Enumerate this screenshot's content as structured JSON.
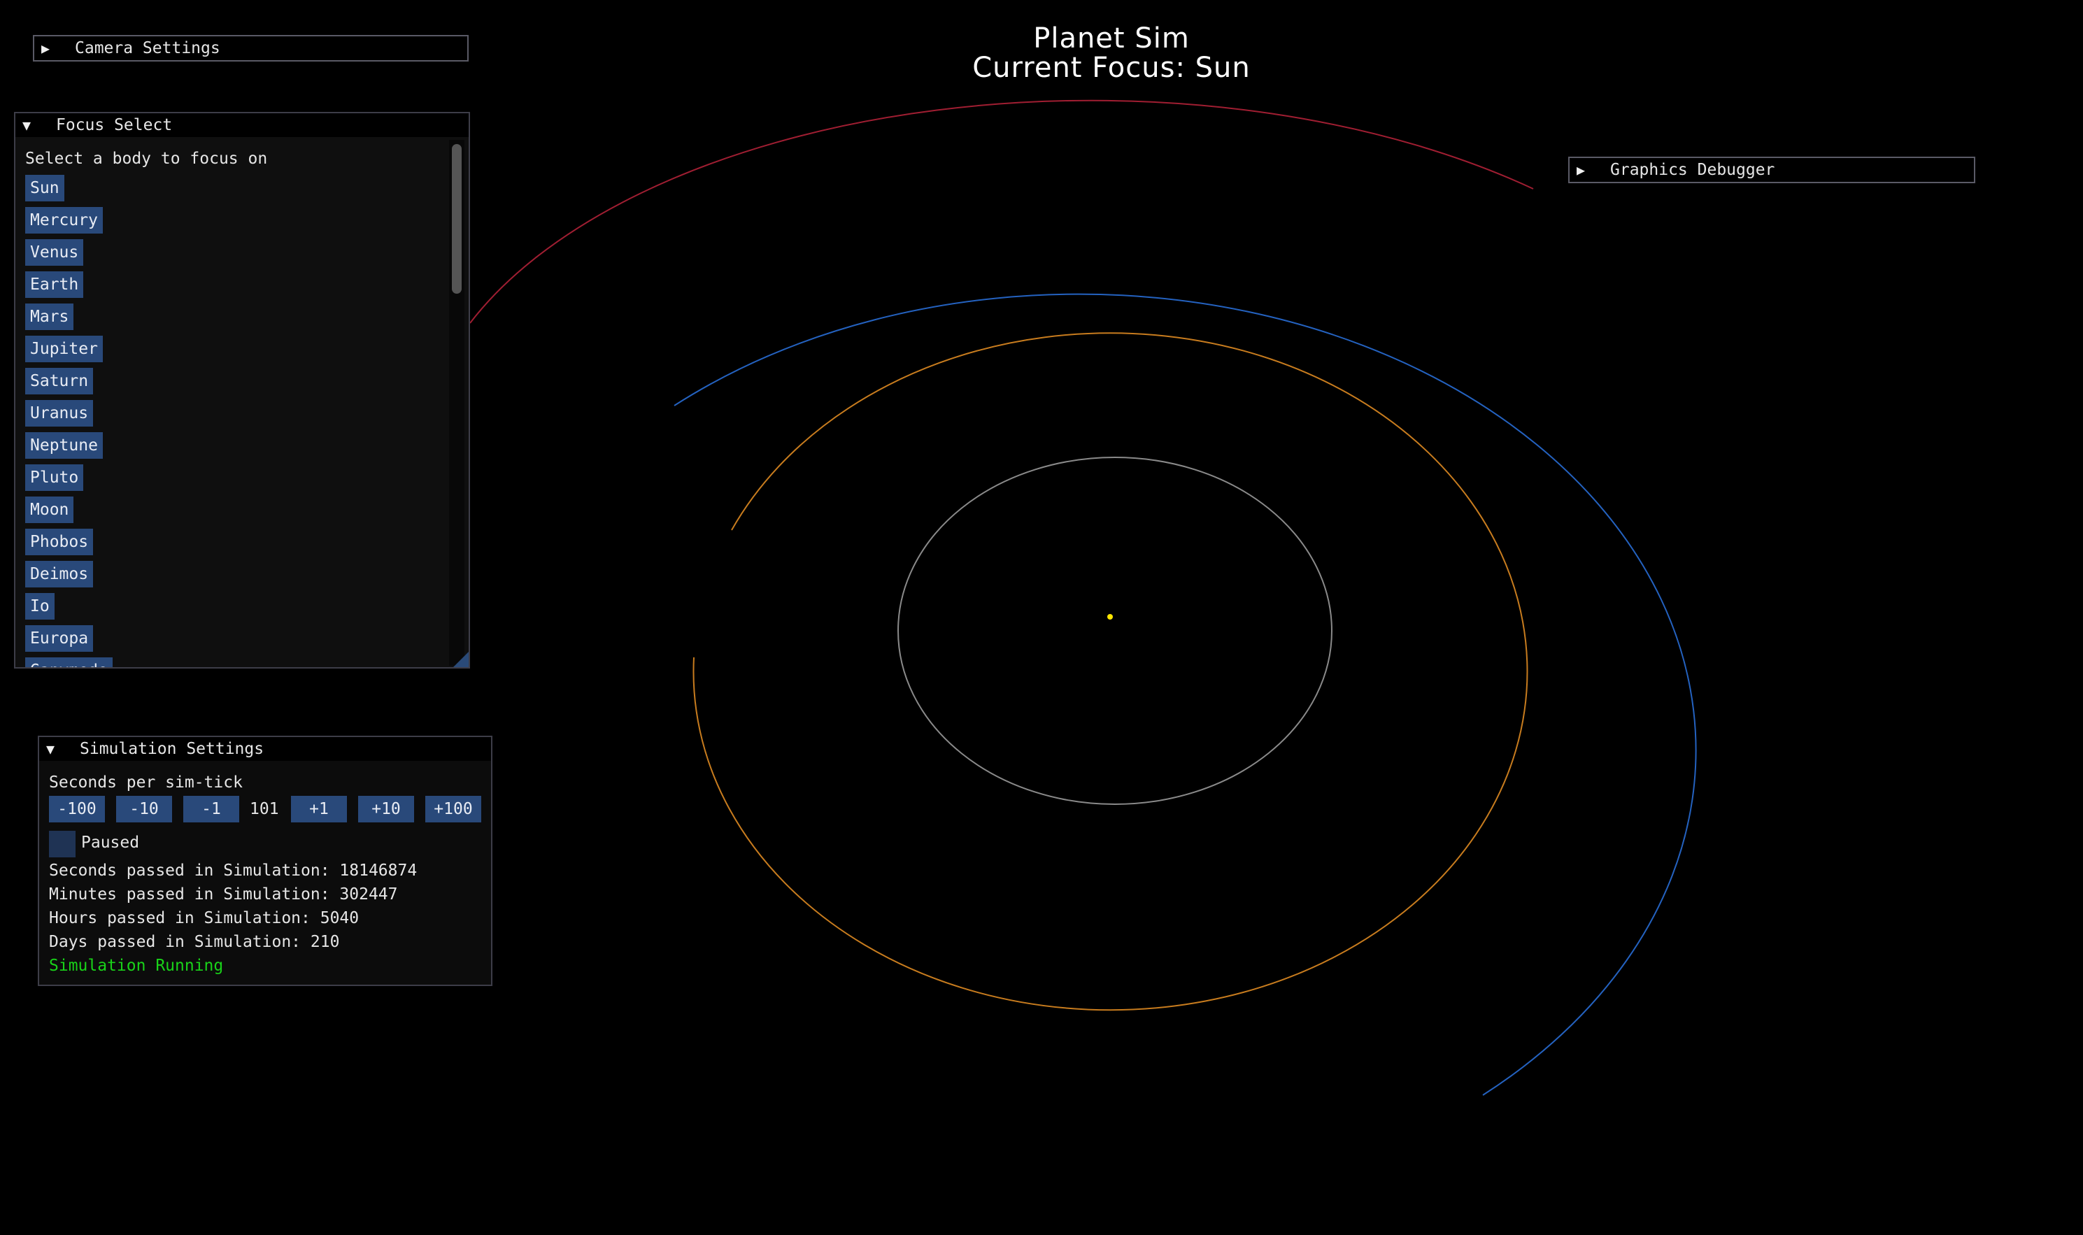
{
  "header": {
    "title": "Planet Sim",
    "focus_label": "Current Focus: Sun"
  },
  "camera_settings": {
    "title": "Camera Settings"
  },
  "graphics_debugger": {
    "title": "Graphics Debugger"
  },
  "focus_select": {
    "title": "Focus Select",
    "prompt": "Select a body to focus on",
    "bodies": [
      "Sun",
      "Mercury",
      "Venus",
      "Earth",
      "Mars",
      "Jupiter",
      "Saturn",
      "Uranus",
      "Neptune",
      "Pluto",
      "Moon",
      "Phobos",
      "Deimos",
      "Io",
      "Europa",
      "Ganymede"
    ]
  },
  "simulation_settings": {
    "title": "Simulation Settings",
    "seconds_label": "Seconds per sim-tick",
    "buttons": [
      "-100",
      "-10",
      "-1",
      "+1",
      "+10",
      "+100"
    ],
    "tick_value": "101",
    "paused_label": "Paused",
    "paused": false,
    "seconds_passed": "Seconds passed in Simulation: 18146874",
    "minutes_passed": "Minutes passed in Simulation: 302447",
    "hours_passed": "Hours passed in Simulation: 5040",
    "days_passed": "Days passed in Simulation: 210",
    "status": "Simulation Running",
    "status_color": "#19d219"
  },
  "colors": {
    "button": "#29497a",
    "orbit_inner": "#8a8a8a",
    "orbit_orange": "#c87c1e",
    "orbit_blue": "#2462c0",
    "orbit_red": "#a01e32",
    "sun": "#ffe600"
  }
}
